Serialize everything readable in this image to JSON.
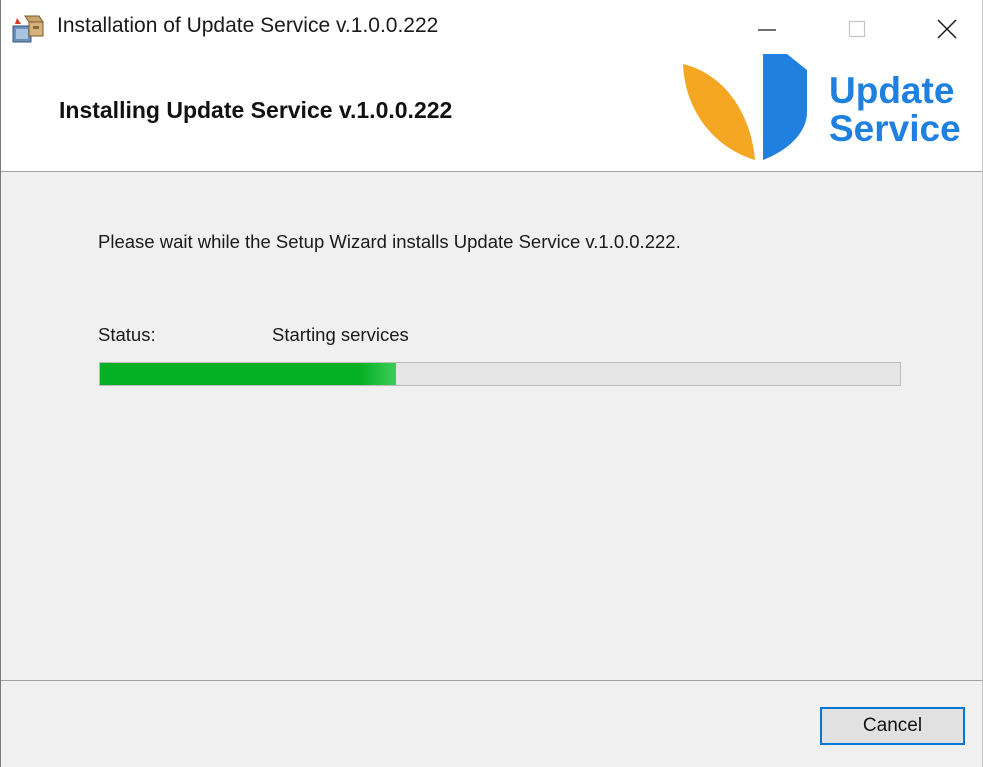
{
  "window": {
    "title": "Installation of Update Service v.1.0.0.222",
    "controls": {
      "minimize_icon": "minimize-icon",
      "maximize_icon": "maximize-icon",
      "close_icon": "close-icon"
    }
  },
  "header": {
    "title": "Installing Update Service v.1.0.0.222",
    "logo": {
      "line1": "Update",
      "line2": "Service",
      "leaf_color": "#f5a623",
      "bar_color": "#1f80e0"
    }
  },
  "body": {
    "wait_message": "Please wait while the Setup Wizard installs Update Service v.1.0.0.222.",
    "status_label": "Status:",
    "status_value": "Starting services",
    "progress_percent": 37,
    "progress_color": "#06b025"
  },
  "footer": {
    "cancel_label": "Cancel",
    "focus_color": "#0078d7"
  }
}
